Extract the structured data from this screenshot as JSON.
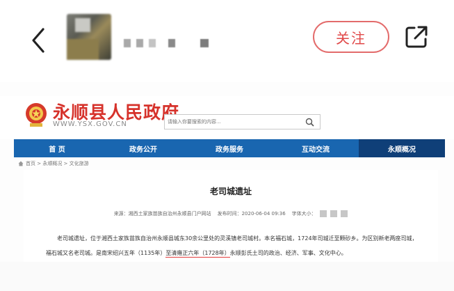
{
  "appbar": {
    "follow_label": "关注",
    "icons": {
      "back": "chevron-left-icon",
      "share": "external-share-icon",
      "avatar": "blurred-avatar"
    }
  },
  "site": {
    "title": "永顺县人民政府",
    "url": "WWW.YSX.GOV.CN",
    "search_placeholder": "请输入你要搜索的内容...",
    "nav": [
      "首 页",
      "政务公开",
      "政务服务",
      "互动交流",
      "永顺概况"
    ],
    "active_nav_index": 4,
    "breadcrumb": "首页 > 永顺概况 > 文化旅游"
  },
  "article": {
    "title": "老司城遗址",
    "meta": {
      "source": "来源：湘西土家族苗族自治州永顺县门户网站",
      "published": "发布时间：2020-06-04 09:36",
      "font_size_label": "字体大小："
    },
    "paragraph_before": "老司城遗址，位于湘西土家族苗族自治州永顺县城东30余公里处的灵溪镇老司城村。本名福石城，1724年司城迁至颗砂乡。为区别新老两座司城，福石城又名老司城。是南宋绍兴五年（1135年）",
    "highlighted": "至清雍正六年（1728年）",
    "paragraph_after": "永顺彭氏土司的政治、经济、军事、文化中心。"
  },
  "colors": {
    "accent_red": "#e04848",
    "title_red": "#d6322b",
    "nav_blue": "#1966b0",
    "nav_active": "#0f3f78",
    "underline_red": "#e23a3a"
  }
}
